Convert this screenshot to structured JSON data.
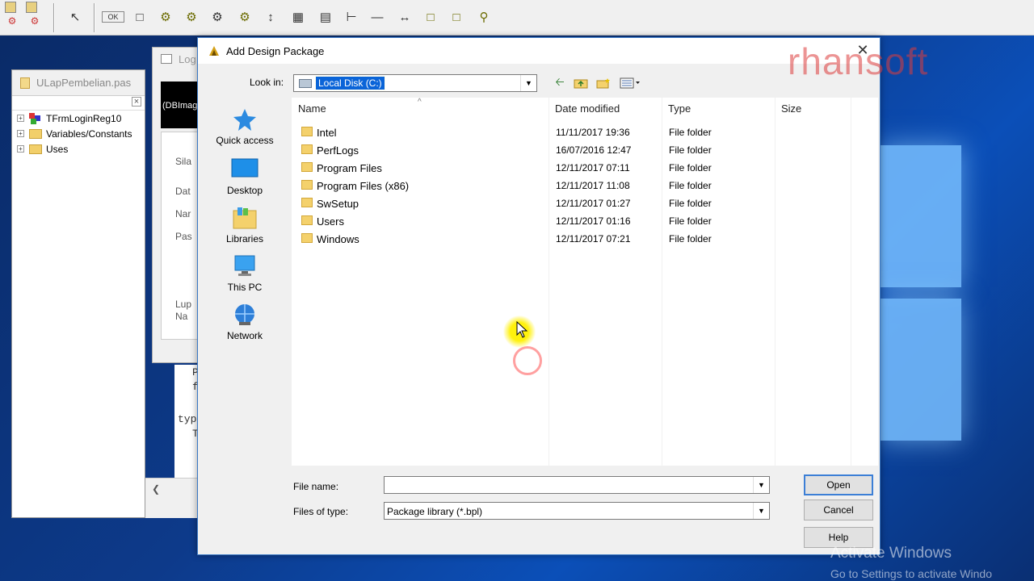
{
  "desktop": {
    "activate_title": "Activate Windows",
    "activate_sub": "Go to Settings to activate Windo"
  },
  "structure": {
    "title": "ULapPembelian.pas",
    "items": [
      {
        "label": "TFrmLoginReg10",
        "icon": "component-icon"
      },
      {
        "label": "Variables/Constants",
        "icon": "folder-icon"
      },
      {
        "label": "Uses",
        "icon": "folder-icon"
      }
    ]
  },
  "designer": {
    "title": "Log",
    "dbimage": "(DBImag",
    "labels": [
      "Sila",
      "Dat",
      "Nar",
      "Pas",
      "Lup",
      "Na"
    ],
    "code": [
      "P",
      "f",
      "typ",
      "T"
    ]
  },
  "dialog": {
    "title": "Add Design Package",
    "watermark": "rhansoft",
    "look_in_label": "Look in:",
    "look_in_value": "Local Disk (C:)",
    "places": [
      "Quick access",
      "Desktop",
      "Libraries",
      "This PC",
      "Network"
    ],
    "columns": [
      "Name",
      "Date modified",
      "Type",
      "Size"
    ],
    "files": [
      {
        "name": "Intel",
        "date": "11/11/2017 19:36",
        "type": "File folder"
      },
      {
        "name": "PerfLogs",
        "date": "16/07/2016 12:47",
        "type": "File folder"
      },
      {
        "name": "Program Files",
        "date": "12/11/2017 07:11",
        "type": "File folder"
      },
      {
        "name": "Program Files (x86)",
        "date": "12/11/2017 11:08",
        "type": "File folder"
      },
      {
        "name": "SwSetup",
        "date": "12/11/2017 01:27",
        "type": "File folder"
      },
      {
        "name": "Users",
        "date": "12/11/2017 01:16",
        "type": "File folder"
      },
      {
        "name": "Windows",
        "date": "12/11/2017 07:21",
        "type": "File folder"
      }
    ],
    "file_name_label": "File name:",
    "file_name_value": "",
    "files_of_type_label": "Files of type:",
    "files_of_type_value": "Package library  (*.bpl)",
    "open_label": "Open",
    "cancel_label": "Cancel",
    "help_label": "Help",
    "colors": {
      "selection": "#0a64d8",
      "folder": "#f4d16c",
      "border": "#3a78c4"
    }
  }
}
